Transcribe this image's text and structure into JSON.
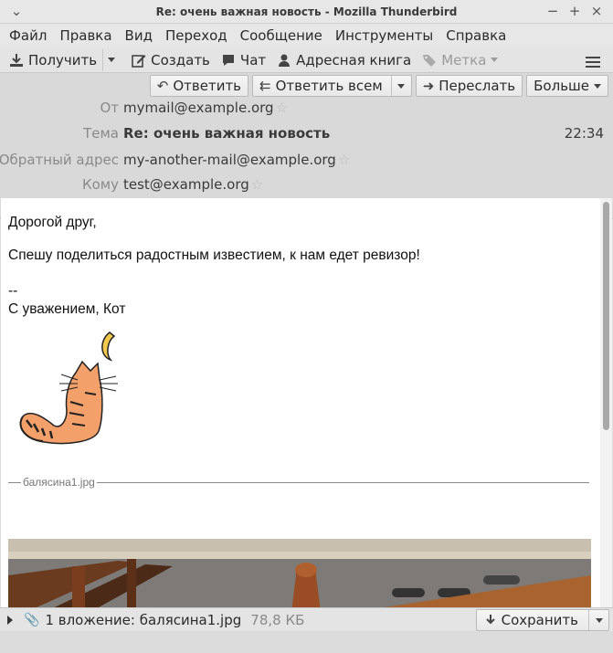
{
  "window": {
    "title": "Re: очень важная новость - Mozilla Thunderbird"
  },
  "menu": [
    "Файл",
    "Правка",
    "Вид",
    "Переход",
    "Сообщение",
    "Инструменты",
    "Справка"
  ],
  "toolbar": {
    "get": "Получить",
    "compose": "Создать",
    "chat": "Чат",
    "addressbook": "Адресная книга",
    "tag": "Метка"
  },
  "actions": {
    "reply": "Ответить",
    "reply_all": "Ответить всем",
    "forward": "Переслать",
    "more": "Больше"
  },
  "headers": {
    "from_label": "От",
    "from": "mymail@example.org",
    "subject_label": "Тема",
    "subject": "Re: очень важная новость",
    "time": "22:34",
    "reply_to_label": "Обратный адрес",
    "reply_to": "my-another-mail@example.org",
    "to_label": "Кому",
    "to": "test@example.org"
  },
  "body": {
    "greeting": "Дорогой друг,",
    "line1": "Спешу поделиться радостным известием, к нам едет ревизор!",
    "sig_sep": "--",
    "signature": "С уважением, Кот",
    "attachment_divider": "балясина1.jpg"
  },
  "attachments": {
    "summary": "1 вложение: балясина1.jpg",
    "size": "78,8 КБ",
    "save": "Сохранить"
  },
  "colors": {
    "accent_cat": "#f4a06b",
    "moon": "#f2c94c"
  }
}
